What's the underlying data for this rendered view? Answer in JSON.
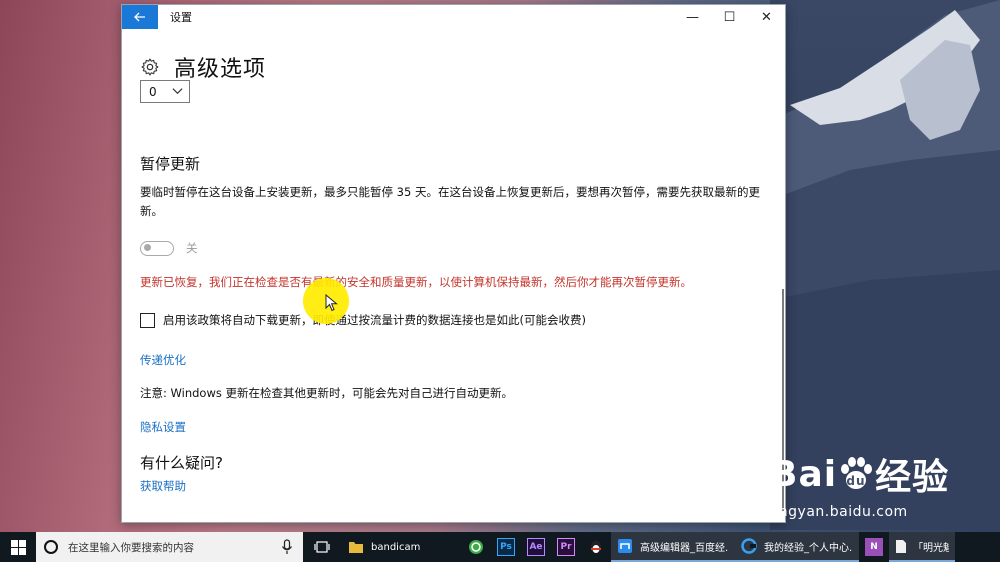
{
  "window": {
    "title": "设置",
    "back_icon": "back-arrow-icon",
    "minimize_glyph": "—",
    "maximize_glyph": "☐",
    "close_glyph": "✕"
  },
  "page": {
    "title": "高级选项",
    "select_value": "0",
    "pause_section": {
      "title": "暂停更新",
      "description": "要临时暂停在这台设备上安装更新，最多只能暂停 35 天。在这台设备上恢复更新后，要想再次暂停，需要先获取最新的更新。",
      "toggle_label": "关",
      "toggle_on": false,
      "warning": "更新已恢复，我们正在检查是否有最新的安全和质量更新，以使计算机保持最新，然后你才能再次暂停更新。"
    },
    "auto_download_checkbox": {
      "checked": false,
      "label": "启用该政策将自动下载更新，即使通过按流量计费的数据连接也是如此(可能会收费)"
    },
    "delivery_link": "传递优化",
    "note": "注意: Windows 更新在检查其他更新时，可能会先对自己进行自动更新。",
    "privacy_link": "隐私设置",
    "help_section": {
      "title": "有什么疑问?",
      "link": "获取帮助"
    }
  },
  "watermark": {
    "logo_text_1": "Bai",
    "logo_text_2": "经验",
    "url": "jingyan.baidu.com"
  },
  "taskbar": {
    "search_placeholder": "在这里输入你要搜索的内容",
    "apps": [
      {
        "name": "bandicam",
        "label": "bandicam",
        "icon": "folder-icon",
        "color": "#e8b93a"
      },
      {
        "name": "green-app",
        "label": "",
        "icon": "green-circle-icon",
        "color": "#3dab4a"
      },
      {
        "name": "photoshop",
        "label": "",
        "icon_text": "Ps",
        "color": "#31a8ff"
      },
      {
        "name": "after-effects",
        "label": "",
        "icon_text": "Ae",
        "color": "#b58aff"
      },
      {
        "name": "premiere",
        "label": "",
        "icon_text": "Pr",
        "color": "#d38aff"
      },
      {
        "name": "qq",
        "label": "",
        "icon": "qq-penguin-icon",
        "color": "#e63a2e"
      },
      {
        "name": "editor",
        "label": "高级编辑器_百度经...",
        "icon": "browser-icon",
        "color": "#2a8cf0"
      },
      {
        "name": "jingyan",
        "label": "我的经验_个人中心...",
        "icon": "browser-c-icon",
        "color": "#38a0f0"
      },
      {
        "name": "onenote",
        "label": "",
        "icon_text": "N",
        "color": "#9b4fb8"
      },
      {
        "name": "word-doc",
        "label": "「明光魅影」",
        "icon": "doc-icon",
        "color": "#f0f0f0"
      }
    ]
  },
  "colors": {
    "accent": "#1a78d6",
    "link": "#1a6fc4",
    "warning": "#c4332b"
  }
}
